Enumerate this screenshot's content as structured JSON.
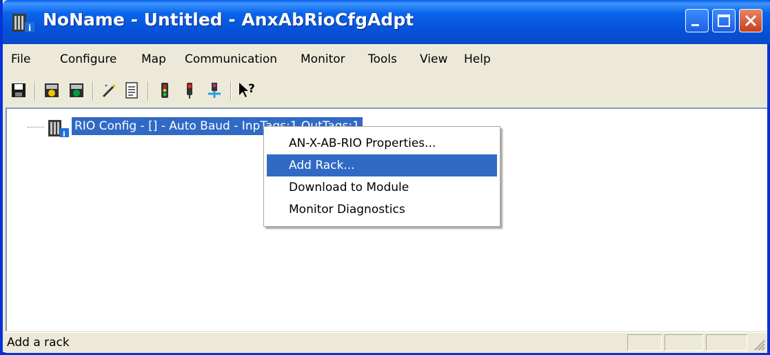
{
  "window": {
    "title": "NoName - Untitled - AnxAbRioCfgAdpt"
  },
  "menubar": {
    "items": [
      {
        "label": "File"
      },
      {
        "label": "Configure"
      },
      {
        "label": "Map"
      },
      {
        "label": "Communication"
      },
      {
        "label": "Monitor"
      },
      {
        "label": "Tools"
      },
      {
        "label": "View"
      },
      {
        "label": "Help"
      }
    ]
  },
  "toolbar": {
    "buttons": [
      {
        "icon": "save-icon"
      },
      {
        "icon": "configure-icon"
      },
      {
        "icon": "configure-map-icon"
      },
      {
        "icon": "magic-wand-icon"
      },
      {
        "icon": "report-icon"
      },
      {
        "icon": "traffic-light-icon"
      },
      {
        "icon": "stop-light-icon"
      },
      {
        "icon": "download-icon"
      },
      {
        "icon": "help-pointer-icon"
      }
    ],
    "help_glyph": "?"
  },
  "tree": {
    "root_label": "RIO Config - [] - Auto Baud - InpTags:1 OutTags:1"
  },
  "context_menu": {
    "items": [
      {
        "label": "AN-X-AB-RIO Properties...",
        "selected": false
      },
      {
        "label": "Add Rack...",
        "selected": true
      },
      {
        "label": "Download to Module",
        "selected": false
      },
      {
        "label": "Monitor Diagnostics",
        "selected": false
      }
    ]
  },
  "statusbar": {
    "text": "Add a rack"
  },
  "colors": {
    "titlebar": "#0a5fe8",
    "selection": "#316ac5",
    "close_button": "#c4401f"
  }
}
